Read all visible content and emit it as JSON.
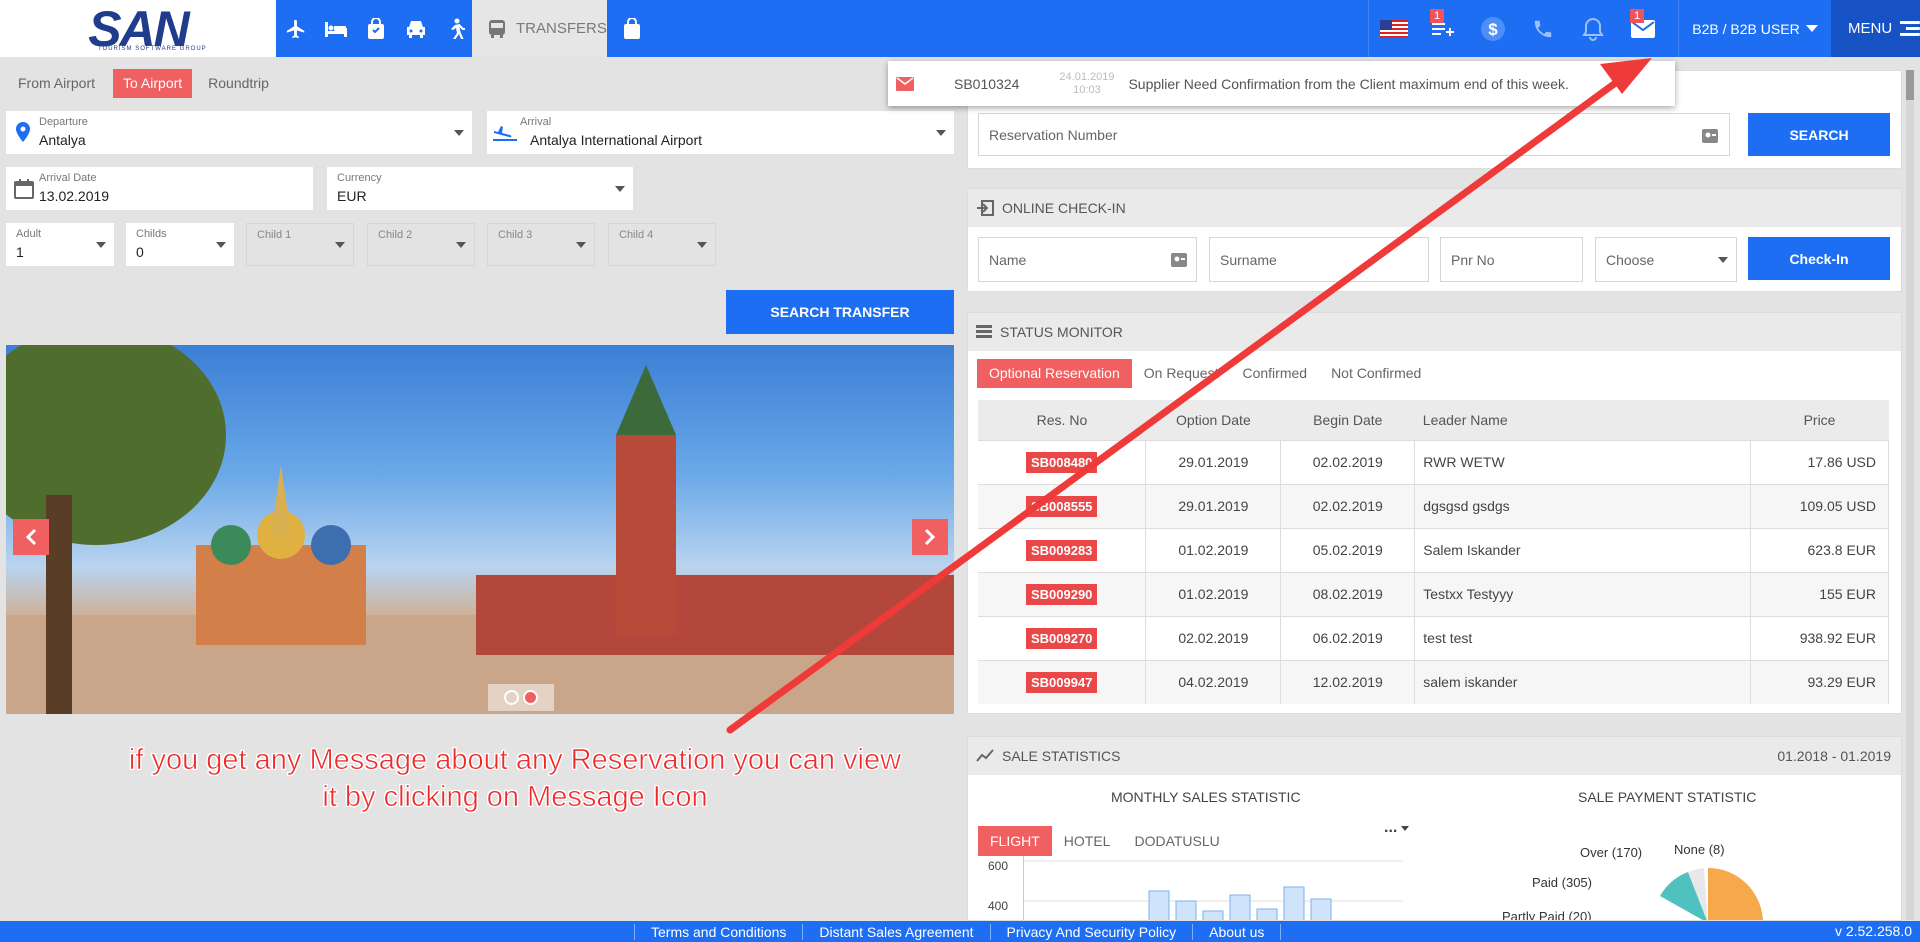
{
  "logo": {
    "text": "SAN",
    "sub": "TOURISM SOFTWARE GROUP"
  },
  "nav": {
    "transfers_label": "TRANSFERS"
  },
  "top_right": {
    "cart_badge": "1",
    "mail_badge": "1",
    "user_label": "B2B / B2B USER",
    "menu_label": "MENU"
  },
  "trip_tabs": [
    "From Airport",
    "To Airport",
    "Roundtrip"
  ],
  "form": {
    "departure_label": "Departure",
    "departure_value": "Antalya",
    "arrival_label": "Arrival",
    "arrival_value": "Antalya International Airport",
    "arrival_date_label": "Arrival Date",
    "arrival_date_value": "13.02.2019",
    "currency_label": "Currency",
    "currency_value": "EUR",
    "adult_label": "Adult",
    "adult_value": "1",
    "childs_label": "Childs",
    "childs_value": "0",
    "child1_label": "Child 1",
    "child2_label": "Child 2",
    "child3_label": "Child 3",
    "child4_label": "Child 4",
    "search_label": "SEARCH TRANSFER"
  },
  "message_popup": {
    "code": "SB010324",
    "date": "24.01.2019",
    "time": "10:03",
    "text": "Supplier Need Confirmation from the Client maximum end of this week."
  },
  "reservation_search": {
    "placeholder": "Reservation Number",
    "button": "SEARCH"
  },
  "checkin": {
    "title": "ONLINE CHECK-IN",
    "name_placeholder": "Name",
    "surname_placeholder": "Surname",
    "pnr_placeholder": "Pnr No",
    "choose": "Choose",
    "button": "Check-In"
  },
  "status_monitor": {
    "title": "STATUS MONITOR",
    "tabs": [
      "Optional Reservation",
      "On Request",
      "Confirmed",
      "Not Confirmed"
    ],
    "columns": [
      "Res. No",
      "Option Date",
      "Begin Date",
      "Leader Name",
      "Price"
    ],
    "rows": [
      {
        "res": "SB008480",
        "option": "29.01.2019",
        "begin": "02.02.2019",
        "leader": "RWR WETW",
        "price": "17.86 USD"
      },
      {
        "res": "SB008555",
        "option": "29.01.2019",
        "begin": "02.02.2019",
        "leader": "dgsgsd gsdgs",
        "price": "109.05 USD"
      },
      {
        "res": "SB009283",
        "option": "01.02.2019",
        "begin": "05.02.2019",
        "leader": "Salem Iskander",
        "price": "623.8 EUR"
      },
      {
        "res": "SB009290",
        "option": "01.02.2019",
        "begin": "08.02.2019",
        "leader": "Testxx Testyyy",
        "price": "155 EUR"
      },
      {
        "res": "SB009270",
        "option": "02.02.2019",
        "begin": "06.02.2019",
        "leader": "test test",
        "price": "938.92 EUR"
      },
      {
        "res": "SB009947",
        "option": "04.02.2019",
        "begin": "12.02.2019",
        "leader": "salem iskander",
        "price": "93.29 EUR"
      }
    ]
  },
  "sale_statistics": {
    "title": "SALE STATISTICS",
    "range": "01.2018 - 01.2019",
    "monthly_title": "MONTHLY SALES STATISTIC",
    "payment_title": "SALE PAYMENT STATISTIC",
    "tabs": [
      "FLIGHT",
      "HOTEL",
      "DODATUSLU"
    ],
    "more": "...",
    "y_ticks": [
      "600",
      "400"
    ],
    "pie_labels": [
      "Over (170)",
      "None (8)",
      "Paid (305)",
      "Partly Paid (20)"
    ]
  },
  "annotation": "if you get any Message about any Reservation you can view it by clicking on Message Icon",
  "footer": {
    "links": [
      "Terms and Conditions",
      "Distant Sales Agreement",
      "Privacy And Security Policy",
      "About us"
    ],
    "version": "v 2.52.258.0"
  },
  "colors": {
    "primary": "#1d6ef3",
    "accent": "#f06060",
    "arrow": "#ef3a3a"
  }
}
